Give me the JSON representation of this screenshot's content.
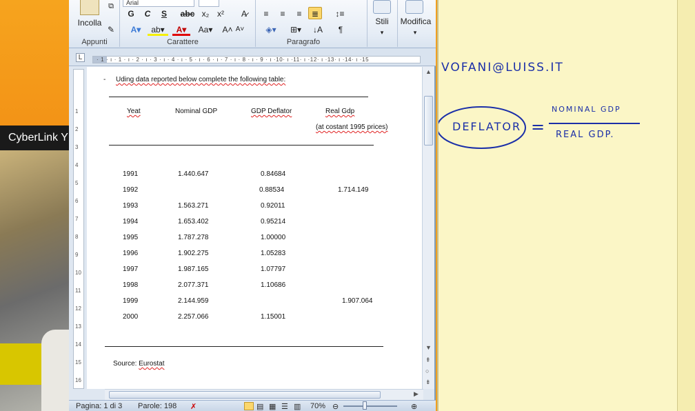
{
  "ribbon": {
    "paste_label": "Incolla",
    "group_clipboard": "Appunti",
    "group_font": "Carattere",
    "group_paragraph": "Paragrafo",
    "styles_label": "Stili",
    "edit_label": "Modifica",
    "font_name": "Arial",
    "btn_bold": "G",
    "btn_italic": "C",
    "btn_underline": "S"
  },
  "taskbar": {
    "cyberlink_label": "CyberLink Y"
  },
  "document": {
    "instruction_dash": "-",
    "instruction": "Uding data reported below complete the following table:",
    "headers": {
      "year": "Yeat",
      "nominal": "Nominal GDP",
      "deflator": "GDP Deflator",
      "real": "Real Gdp",
      "real_sub": "(at costant 1995 prices)"
    },
    "rows": [
      {
        "year": "1991",
        "nominal": "1.440.647",
        "deflator": "0.84684",
        "real": ""
      },
      {
        "year": "1992",
        "nominal": "",
        "deflator": "0.88534",
        "real": "1.714.149"
      },
      {
        "year": "1993",
        "nominal": "1.563.271",
        "deflator": "0.92011",
        "real": ""
      },
      {
        "year": "1994",
        "nominal": "1.653.402",
        "deflator": "0.95214",
        "real": ""
      },
      {
        "year": "1995",
        "nominal": "1.787.278",
        "deflator": "1.00000",
        "real": ""
      },
      {
        "year": "1996",
        "nominal": "1.902.275",
        "deflator": "1.05283",
        "real": ""
      },
      {
        "year": "1997",
        "nominal": "1.987.165",
        "deflator": "1.07797",
        "real": ""
      },
      {
        "year": "1998",
        "nominal": "2.077.371",
        "deflator": "1.10686",
        "real": ""
      },
      {
        "year": "1999",
        "nominal": "2.144.959",
        "deflator": "",
        "real": "1.907.064"
      },
      {
        "year": "2000",
        "nominal": "2.257.066",
        "deflator": "1.15001",
        "real": ""
      }
    ],
    "source_prefix": "Source: ",
    "source_name": "Eurostat"
  },
  "status": {
    "page": "Pagina: 1 di 3",
    "words": "Parole: 198",
    "zoom": "70%"
  },
  "whiteboard": {
    "email": "VOFANI@LUISS.IT",
    "deflator": "DEFLATOR",
    "equals": "=",
    "numerator": "NOMINAL GDP",
    "denominator": "REAL GDP."
  }
}
